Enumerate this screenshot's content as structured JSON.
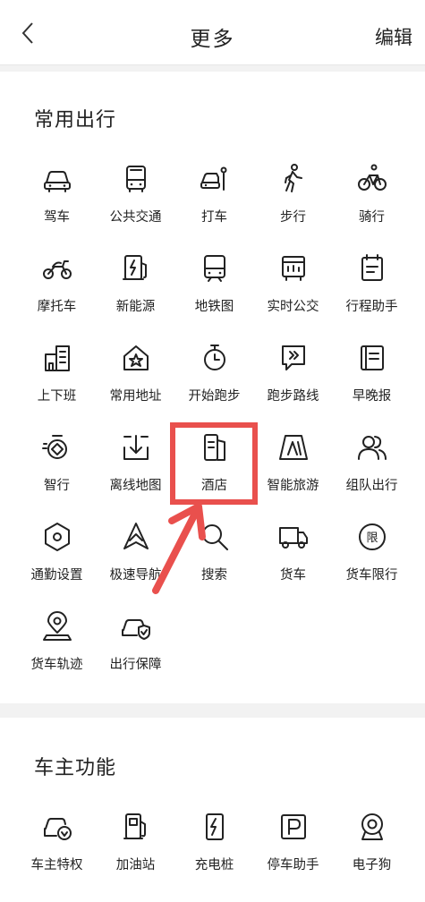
{
  "header": {
    "title": "更多",
    "edit_label": "编辑"
  },
  "sections": [
    {
      "title": "常用出行",
      "items": [
        {
          "label": "驾车",
          "icon": "car-icon"
        },
        {
          "label": "公共交通",
          "icon": "bus-icon"
        },
        {
          "label": "打车",
          "icon": "taxi-icon"
        },
        {
          "label": "步行",
          "icon": "walk-icon"
        },
        {
          "label": "骑行",
          "icon": "bike-icon"
        },
        {
          "label": "摩托车",
          "icon": "motorcycle-icon"
        },
        {
          "label": "新能源",
          "icon": "ev-icon"
        },
        {
          "label": "地铁图",
          "icon": "subway-icon"
        },
        {
          "label": "实时公交",
          "icon": "realtime-bus-icon"
        },
        {
          "label": "行程助手",
          "icon": "trip-assistant-icon"
        },
        {
          "label": "上下班",
          "icon": "commute-icon"
        },
        {
          "label": "常用地址",
          "icon": "home-star-icon"
        },
        {
          "label": "开始跑步",
          "icon": "stopwatch-icon"
        },
        {
          "label": "跑步路线",
          "icon": "running-route-icon"
        },
        {
          "label": "早晚报",
          "icon": "report-icon"
        },
        {
          "label": "智行",
          "icon": "smart-travel-icon"
        },
        {
          "label": "离线地图",
          "icon": "download-icon"
        },
        {
          "label": "酒店",
          "icon": "hotel-icon"
        },
        {
          "label": "智能旅游",
          "icon": "smart-tour-icon"
        },
        {
          "label": "组队出行",
          "icon": "group-icon"
        },
        {
          "label": "通勤设置",
          "icon": "settings-hex-icon"
        },
        {
          "label": "极速导航",
          "icon": "navigation-icon"
        },
        {
          "label": "搜索",
          "icon": "search-icon"
        },
        {
          "label": "货车",
          "icon": "truck-icon"
        },
        {
          "label": "货车限行",
          "icon": "truck-limit-icon"
        },
        {
          "label": "货车轨迹",
          "icon": "location-track-icon"
        },
        {
          "label": "出行保障",
          "icon": "car-shield-icon"
        }
      ]
    },
    {
      "title": "车主功能",
      "items": [
        {
          "label": "车主特权",
          "icon": "car-privilege-icon"
        },
        {
          "label": "加油站",
          "icon": "gas-station-icon"
        },
        {
          "label": "充电桩",
          "icon": "charging-pile-icon"
        },
        {
          "label": "停车助手",
          "icon": "parking-icon"
        },
        {
          "label": "电子狗",
          "icon": "camera-icon"
        }
      ]
    }
  ],
  "colors": {
    "highlight": "#e9504d",
    "text": "#222222",
    "background": "#f2f2f2"
  }
}
